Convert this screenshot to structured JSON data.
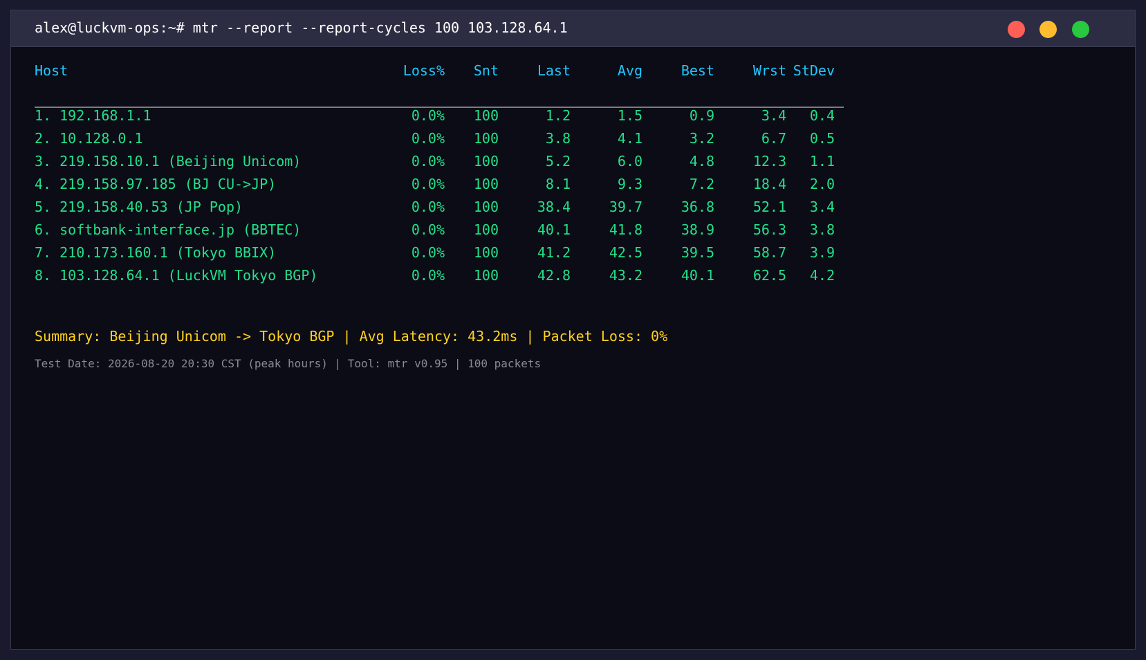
{
  "window": {
    "command": "alex@luckvm-ops:~# mtr --report --report-cycles 100 103.128.64.1",
    "colors": {
      "close": "#ff5f57",
      "minimize": "#febc2e",
      "maximize": "#28c840"
    }
  },
  "table": {
    "headers": {
      "host": "Host",
      "loss": "Loss%",
      "snt": "Snt",
      "last": "Last",
      "avg": "Avg",
      "best": "Best",
      "wrst": "Wrst",
      "stdev": "StDev"
    },
    "rows": [
      {
        "host": "1. 192.168.1.1",
        "loss": "0.0%",
        "snt": "100",
        "last": "1.2",
        "avg": "1.5",
        "best": "0.9",
        "wrst": "3.4",
        "stdev": "0.4"
      },
      {
        "host": "2. 10.128.0.1",
        "loss": "0.0%",
        "snt": "100",
        "last": "3.8",
        "avg": "4.1",
        "best": "3.2",
        "wrst": "6.7",
        "stdev": "0.5"
      },
      {
        "host": "3. 219.158.10.1 (Beijing Unicom)",
        "loss": "0.0%",
        "snt": "100",
        "last": "5.2",
        "avg": "6.0",
        "best": "4.8",
        "wrst": "12.3",
        "stdev": "1.1"
      },
      {
        "host": "4. 219.158.97.185 (BJ CU->JP)",
        "loss": "0.0%",
        "snt": "100",
        "last": "8.1",
        "avg": "9.3",
        "best": "7.2",
        "wrst": "18.4",
        "stdev": "2.0"
      },
      {
        "host": "5. 219.158.40.53 (JP Pop)",
        "loss": "0.0%",
        "snt": "100",
        "last": "38.4",
        "avg": "39.7",
        "best": "36.8",
        "wrst": "52.1",
        "stdev": "3.4"
      },
      {
        "host": "6. softbank-interface.jp (BBTEC)",
        "loss": "0.0%",
        "snt": "100",
        "last": "40.1",
        "avg": "41.8",
        "best": "38.9",
        "wrst": "56.3",
        "stdev": "3.8"
      },
      {
        "host": "7. 210.173.160.1 (Tokyo BBIX)",
        "loss": "0.0%",
        "snt": "100",
        "last": "41.2",
        "avg": "42.5",
        "best": "39.5",
        "wrst": "58.7",
        "stdev": "3.9"
      },
      {
        "host": "8. 103.128.64.1 (LuckVM Tokyo BGP)",
        "loss": "0.0%",
        "snt": "100",
        "last": "42.8",
        "avg": "43.2",
        "best": "40.1",
        "wrst": "62.5",
        "stdev": "4.2"
      }
    ]
  },
  "summary": "Summary: Beijing Unicom -> Tokyo BGP | Avg Latency: 43.2ms | Packet Loss: 0%",
  "footer": "Test Date: 2026-08-20 20:30 CST (peak hours) | Tool: mtr v0.95 | 100 packets"
}
